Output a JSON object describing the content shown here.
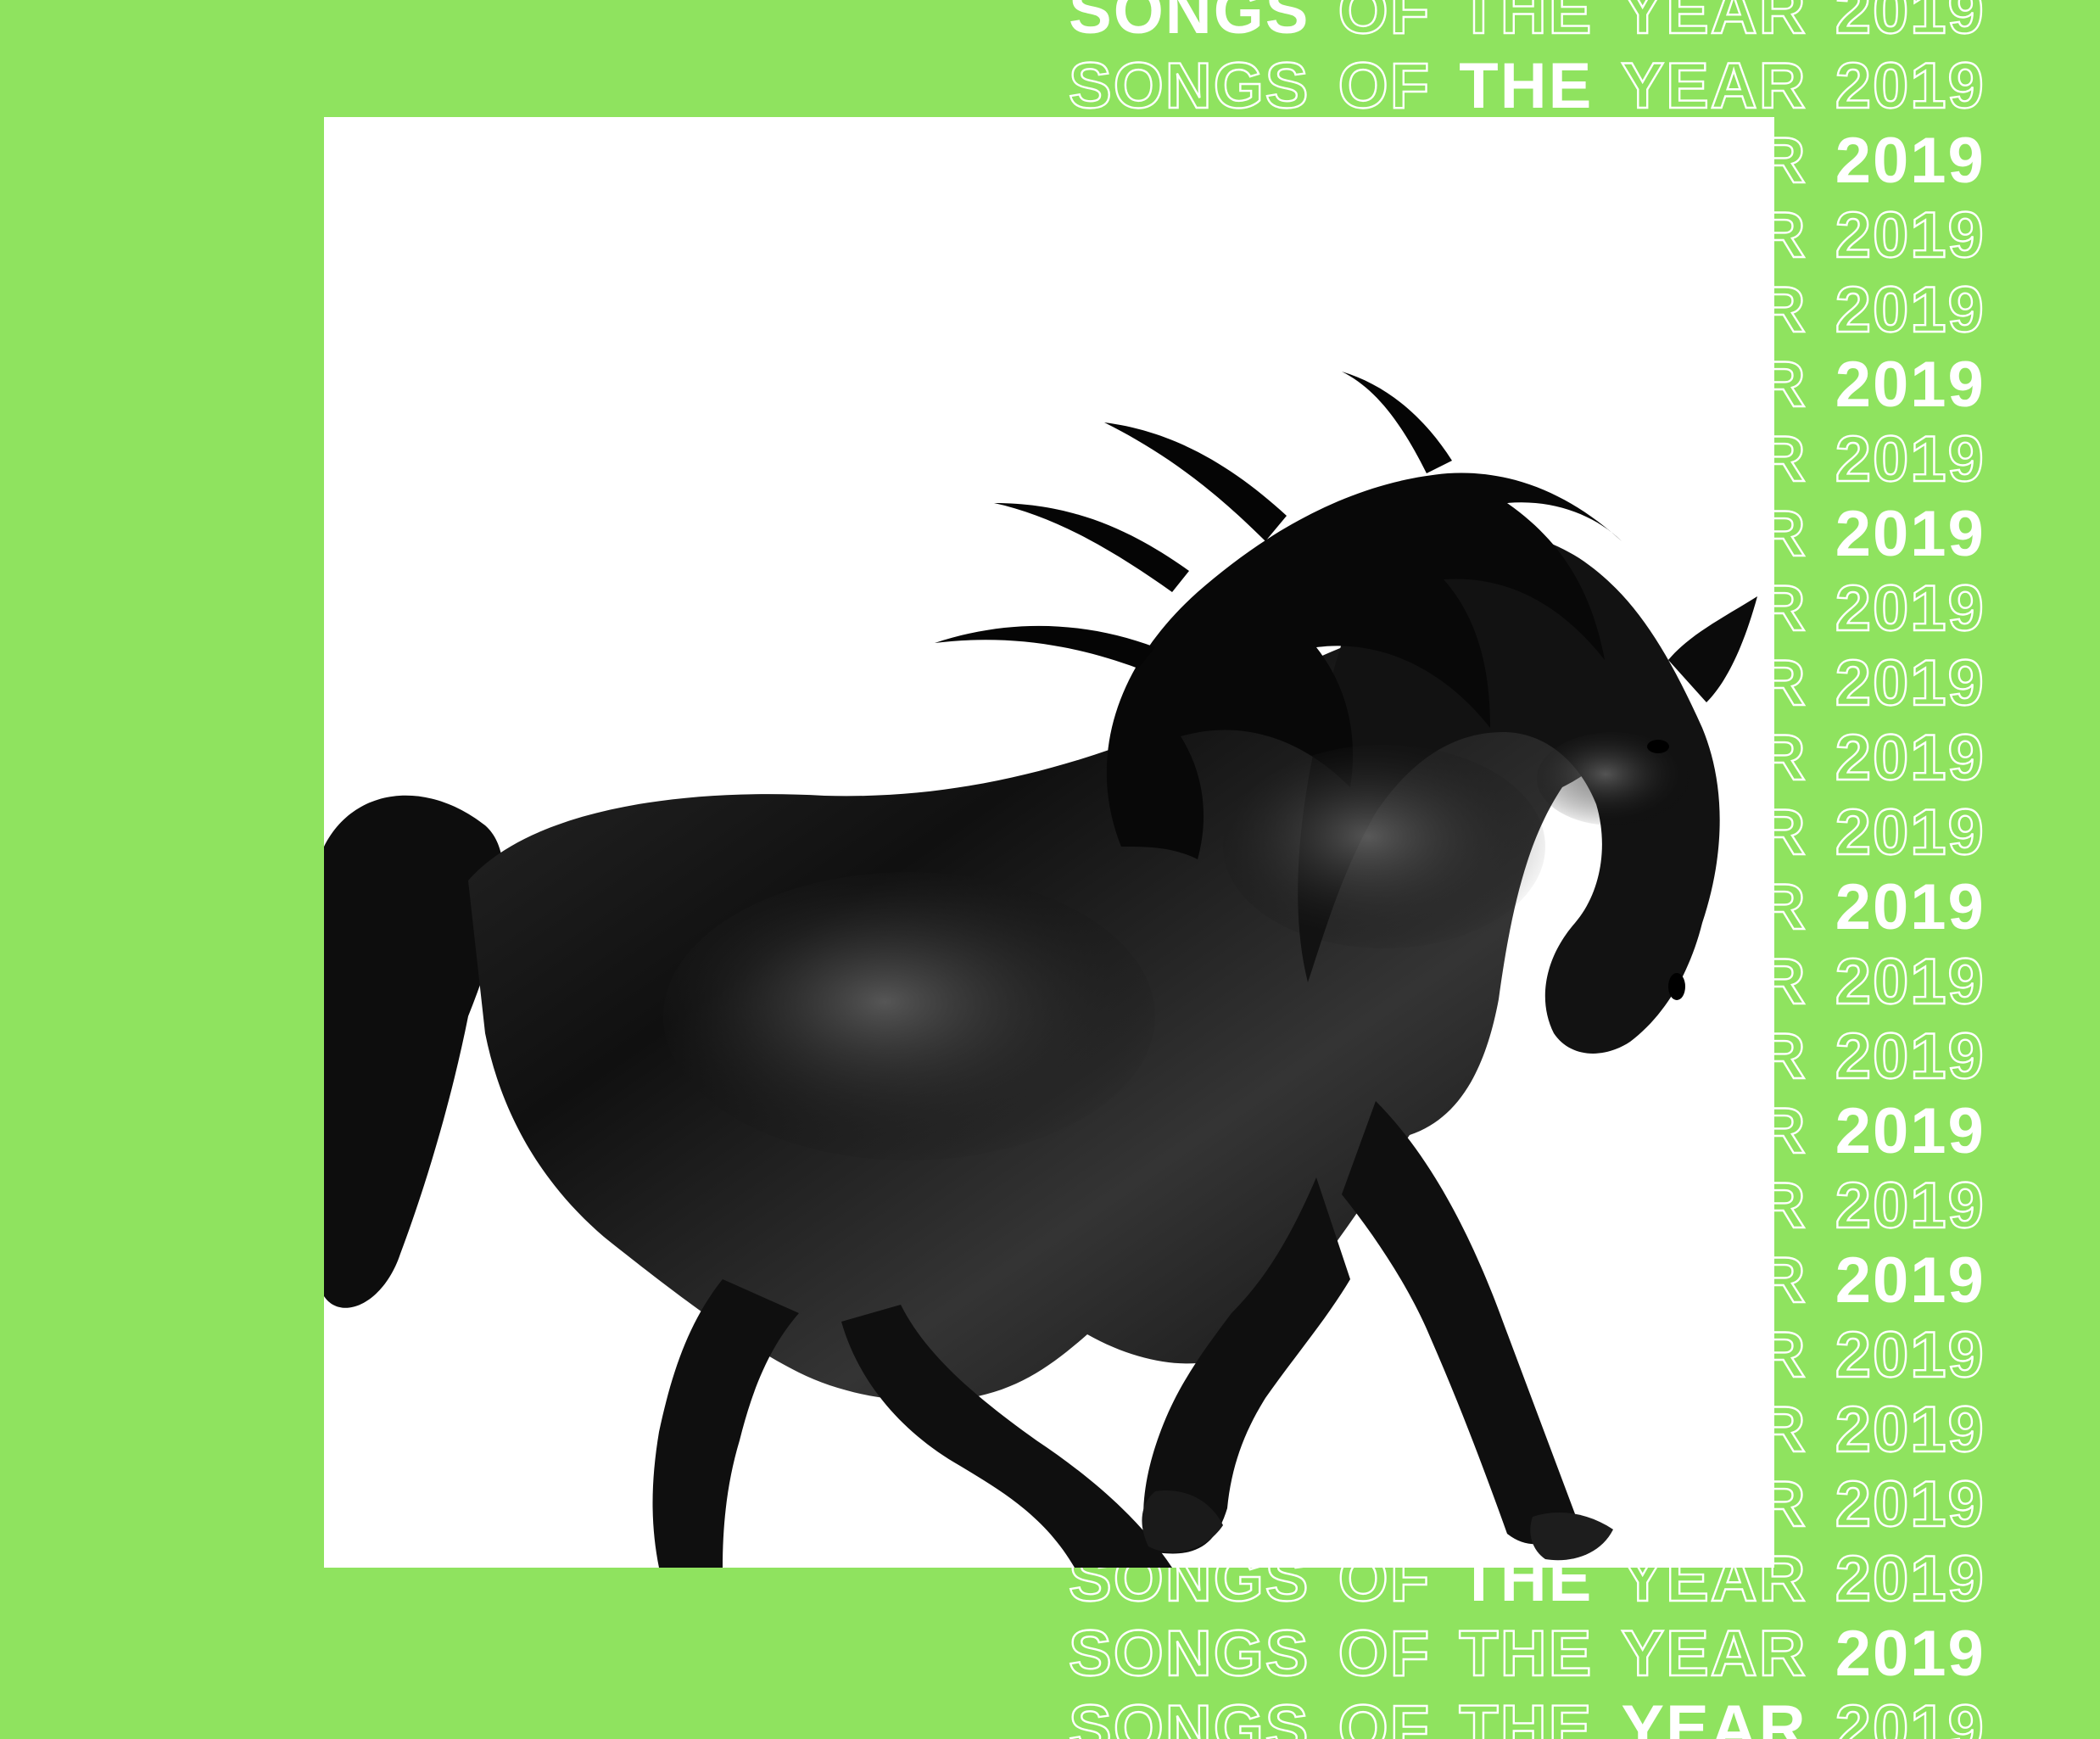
{
  "banner": {
    "words": [
      "SONGS",
      "OF",
      "THE",
      "YEAR",
      "2019"
    ],
    "rows": [
      {
        "filled": [
          0
        ]
      },
      {
        "filled": [
          2
        ]
      },
      {
        "filled": [
          4
        ]
      },
      {
        "filled": []
      },
      {
        "filled": []
      },
      {
        "filled": [
          4
        ]
      },
      {
        "filled": []
      },
      {
        "filled": [
          4
        ]
      },
      {
        "filled": []
      },
      {
        "filled": []
      },
      {
        "filled": []
      },
      {
        "filled": []
      },
      {
        "filled": [
          4
        ]
      },
      {
        "filled": []
      },
      {
        "filled": []
      },
      {
        "filled": [
          4
        ]
      },
      {
        "filled": []
      },
      {
        "filled": [
          4
        ]
      },
      {
        "filled": []
      },
      {
        "filled": []
      },
      {
        "filled": []
      },
      {
        "filled": [
          2
        ]
      },
      {
        "filled": [
          4
        ]
      },
      {
        "filled": [
          3
        ]
      }
    ]
  },
  "artwork": {
    "subject": "horse-image",
    "background": "#ffffff"
  },
  "colors": {
    "background": "#8fe35f",
    "text": "#ffffff",
    "horse": "#111111"
  }
}
